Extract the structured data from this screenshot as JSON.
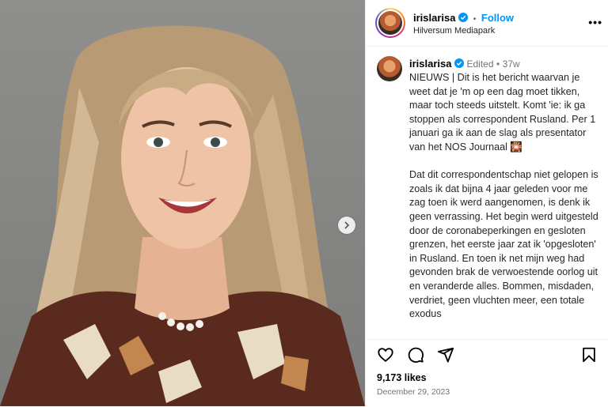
{
  "post": {
    "username": "irislarisa",
    "follow_label": "Follow",
    "location": "Hilversum Mediapark",
    "more_label": "•••",
    "separator": "•"
  },
  "caption": {
    "username": "irislarisa",
    "edited_label": "Edited",
    "age": "37w",
    "text": "NIEUWS | Dit is het bericht waarvan je weet dat je 'm op een dag moet tikken, maar toch steeds uitstelt. Komt 'ie: ik ga stoppen als correspondent Rusland. Per 1 januari ga ik aan de slag als presentator van het NOS Journaal\n\nDat dit correspondentschap niet gelopen is zoals ik dat bijna 4 jaar geleden voor me zag toen ik werd aangenomen, is denk ik geen verrassing. Het begin werd uitgesteld door de coronabeperkingen en gesloten grenzen, het eerste jaar zat ik 'opgesloten' in Rusland. En toen ik net mijn weg had gevonden brak de verwoestende oorlog uit en veranderde alles. Bommen, misdaden, verdriet, geen vluchten meer, een totale exodus",
    "emoji": "🎇"
  },
  "icons": {
    "like": "heart-icon",
    "comment": "comment-icon",
    "share": "share-icon",
    "save": "bookmark-icon",
    "next": "chevron-right-icon",
    "verified": "verified-badge-icon"
  },
  "stats": {
    "likes": "9,173 likes",
    "date": "December 29, 2023"
  },
  "colors": {
    "accent": "#0095f6",
    "verified": "#0095f6",
    "muted": "#737373"
  }
}
